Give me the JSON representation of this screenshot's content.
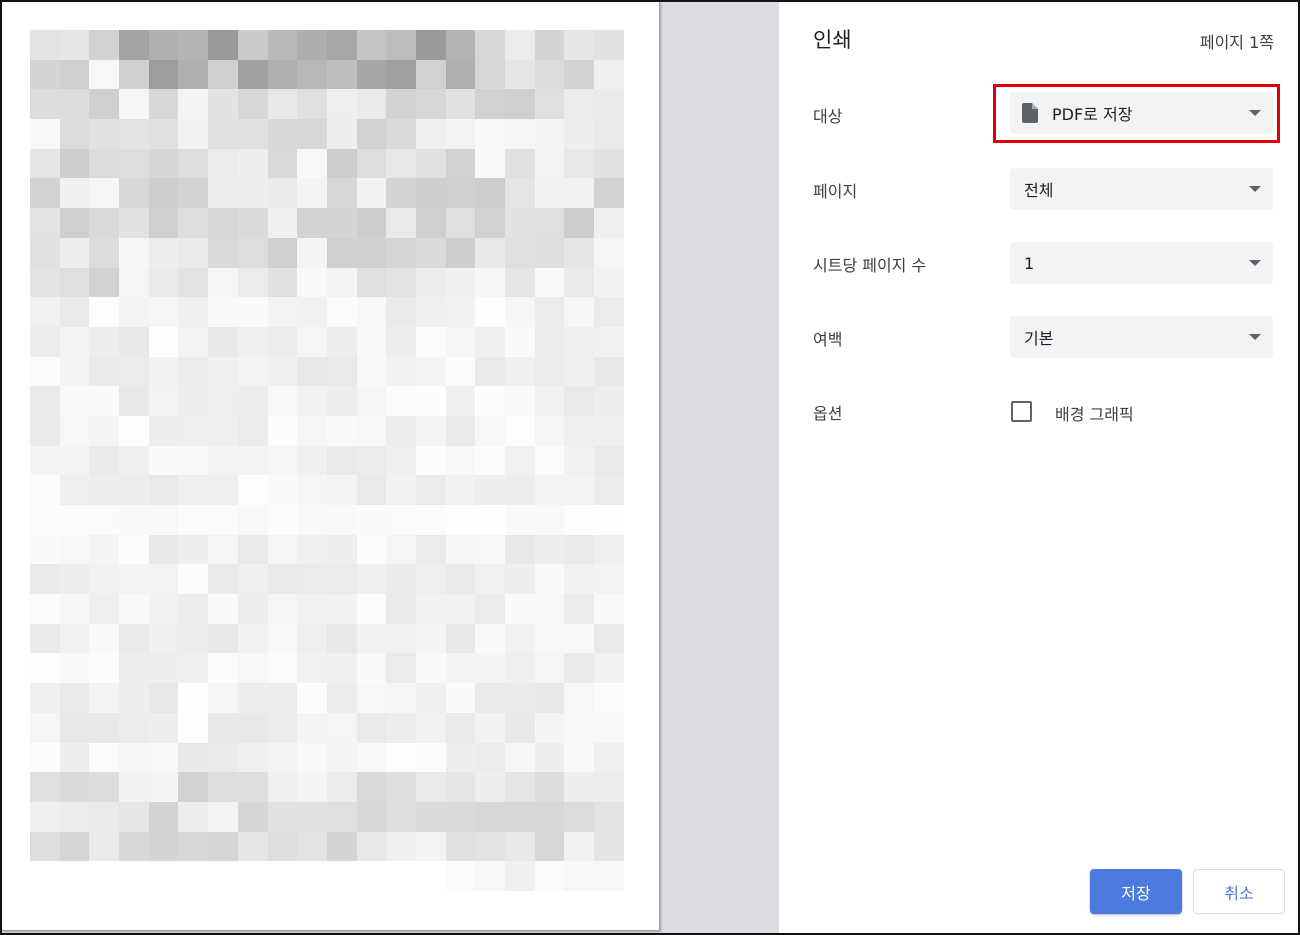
{
  "panel": {
    "title": "인쇄",
    "page_count": "페이지 1쪽"
  },
  "settings": {
    "destination": {
      "label": "대상",
      "value": "PDF로 저장",
      "icon": "file-icon"
    },
    "pages": {
      "label": "페이지",
      "value": "전체"
    },
    "pages_per_sheet": {
      "label": "시트당 페이지 수",
      "value": "1"
    },
    "margins": {
      "label": "여백",
      "value": "기본"
    },
    "options": {
      "label": "옵션",
      "background_graphics_label": "배경 그래픽",
      "background_graphics_checked": false
    }
  },
  "buttons": {
    "save": "저장",
    "cancel": "취소"
  },
  "colors": {
    "accent": "#4c7be0",
    "highlight": "#e0000b",
    "select_bg": "#f1f3f4",
    "preview_bg": "#dadce0"
  }
}
